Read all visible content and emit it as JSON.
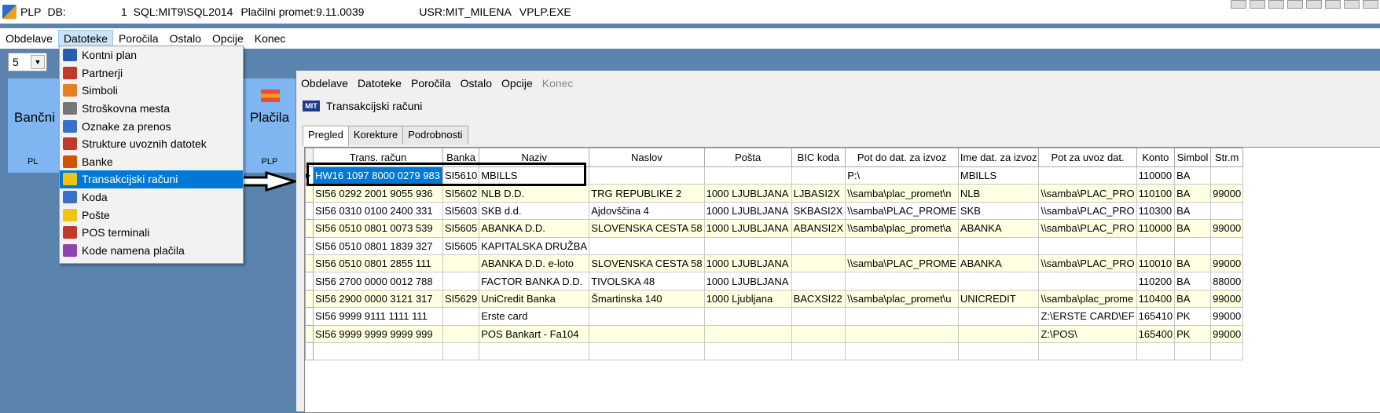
{
  "titlebar": {
    "app": "PLP",
    "db_label": "DB:",
    "db_value": "1",
    "sql": "SQL:MIT9\\SQL2014",
    "module": "Plačilni promet:9.11.0039",
    "user": "USR:MIT_MILENA",
    "exe": "VPLP.EXE"
  },
  "menubar": [
    "Obdelave",
    "Datoteke",
    "Poročila",
    "Ostalo",
    "Opcije",
    "Konec"
  ],
  "combo": {
    "value": "5"
  },
  "tiles": [
    {
      "label": "Bančni",
      "sub": "PL"
    },
    {
      "label": "Plačila",
      "sub": "PLP"
    }
  ],
  "dropdown": {
    "items": [
      {
        "label": "Kontni plan",
        "icon": "text-tt-icon",
        "color": "#2a5db0"
      },
      {
        "label": "Partnerji",
        "icon": "people-icon",
        "color": "#c0392b"
      },
      {
        "label": "Simboli",
        "icon": "pf-icon",
        "color": "#e67e22"
      },
      {
        "label": "Stroškovna mesta",
        "icon": "hierarchy-icon",
        "color": "#777777"
      },
      {
        "label": "Oznake za prenos",
        "icon": "list-icon",
        "color": "#3a70c8"
      },
      {
        "label": "Strukture uvoznih datotek",
        "icon": "tools-icon",
        "color": "#c0392b"
      },
      {
        "label": "Banke",
        "icon": "bank-icon",
        "color": "#d35400"
      },
      {
        "label": "Transakcijski računi",
        "icon": "coin-icon",
        "color": "#f1c40f"
      },
      {
        "label": "Koda",
        "icon": "list-icon",
        "color": "#3a70c8"
      },
      {
        "label": "Pošte",
        "icon": "post-icon",
        "color": "#f1c40f"
      },
      {
        "label": "POS terminali",
        "icon": "pos-icon",
        "color": "#c0392b"
      },
      {
        "label": "Kode namena plačila",
        "icon": "barcode-icon",
        "color": "#8e44ad"
      }
    ],
    "selected_index": 7
  },
  "child": {
    "menu": [
      "Obdelave",
      "Datoteke",
      "Poročila",
      "Ostalo",
      "Opcije",
      "Konec"
    ],
    "title": "Transakcijski računi",
    "title_icon_text": "MIT",
    "tabs": [
      "Pregled",
      "Korekture",
      "Podrobnosti"
    ]
  },
  "grid": {
    "columns": [
      "Trans. račun",
      "Banka",
      "Naziv",
      "Naslov",
      "Pošta",
      "BIC koda",
      "Pot do dat. za izvoz",
      "Ime dat. za izvoz",
      "Pot za uvoz dat.",
      "Konto",
      "Simbol",
      "Str.m"
    ],
    "rows": [
      [
        "HW16 1097 8000 0279 983",
        "SI5610",
        "MBILLS",
        "",
        "",
        "",
        "P:\\",
        "MBILLS",
        "",
        "110000",
        "BA",
        ""
      ],
      [
        "SI56 0292 2001 9055 936",
        "SI5602",
        "NLB D.D.",
        "TRG REPUBLIKE 2",
        "1000 LJUBLJANA",
        "LJBASI2X",
        "\\\\samba\\plac_promet\\n",
        "NLB",
        "\\\\samba\\PLAC_PRO",
        "110100",
        "BA",
        "99000"
      ],
      [
        "SI56 0310 0100 2400 331",
        "SI5603",
        "SKB d.d.",
        "Ajdovščina 4",
        "1000 LJUBLJANA",
        "SKBASI2X",
        "\\\\samba\\PLAC_PROME",
        "SKB",
        "\\\\samba\\PLAC_PRO",
        "110300",
        "BA",
        ""
      ],
      [
        "SI56 0510 0801 0073 539",
        "SI5605",
        "ABANKA D.D.",
        "SLOVENSKA CESTA 58",
        "1000 LJUBLJANA",
        "ABANSI2X",
        "\\\\samba\\plac_promet\\a",
        "ABANKA",
        "\\\\samba\\PLAC_PRO",
        "110000",
        "BA",
        "99000"
      ],
      [
        "SI56 0510 0801 1839 327",
        "SI5605",
        "KAPITALSKA DRUŽBA",
        "",
        "",
        "",
        "",
        "",
        "",
        "",
        "",
        ""
      ],
      [
        "SI56 0510 0801 2855 111",
        "",
        "ABANKA D.D. e-loto",
        "SLOVENSKA CESTA 58",
        "1000 LJUBLJANA",
        "",
        "\\\\samba\\PLAC_PROME",
        "ABANKA",
        "\\\\samba\\PLAC_PRO",
        "110010",
        "BA",
        "99000"
      ],
      [
        "SI56 2700 0000 0012 788",
        "",
        "FACTOR BANKA D.D.",
        "TIVOLSKA  48",
        "1000 LJUBLJANA",
        "",
        "",
        "",
        "",
        "110200",
        "BA",
        "88000"
      ],
      [
        "SI56 2900 0000 3121 317",
        "SI5629",
        "UniCredit Banka",
        "Šmartinska 140",
        "1000 Ljubljana",
        "BACXSI22",
        "\\\\samba\\plac_promet\\u",
        "UNICREDIT",
        "\\\\samba\\plac_prome",
        "110400",
        "BA",
        "99000"
      ],
      [
        "SI56 9999 9111 1111 111",
        "",
        "Erste card",
        "",
        "",
        "",
        "",
        "",
        "Z:\\ERSTE CARD\\EF",
        "165410",
        "PK",
        "99000"
      ],
      [
        "SI56 9999 9999 9999 999",
        "",
        "POS Bankart - Fa104",
        "",
        "",
        "",
        "",
        "",
        "Z:\\POS\\",
        "165400",
        "PK",
        "99000"
      ],
      [
        "",
        "",
        "",
        "",
        "",
        "",
        "",
        "",
        "",
        "",
        "",
        ""
      ]
    ]
  }
}
